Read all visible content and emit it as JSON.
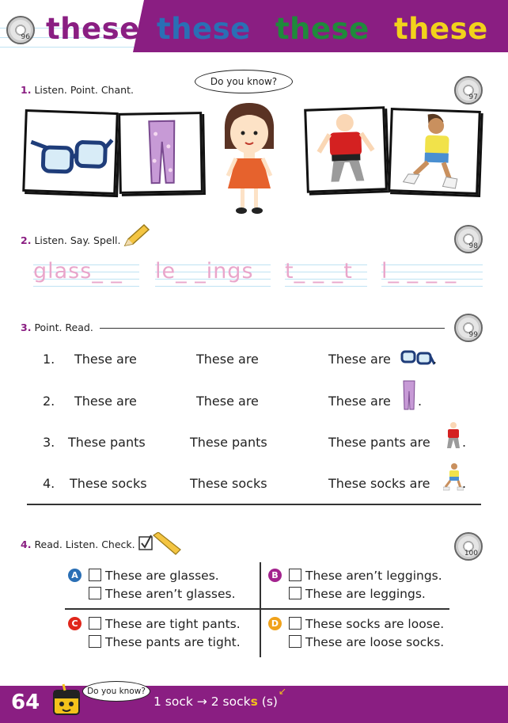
{
  "header": {
    "words": [
      {
        "text": "these",
        "color": "#8a1e82"
      },
      {
        "text": "these",
        "color": "#2a6fb5"
      },
      {
        "text": "these",
        "color": "#1f8a3b"
      },
      {
        "text": "these",
        "color": "#f2d21b"
      }
    ],
    "cd_track": "96"
  },
  "section1": {
    "number": "1.",
    "title": "Listen. Point. Chant.",
    "cd_track": "97",
    "bubble": "Do you know?"
  },
  "section2": {
    "number": "2.",
    "title": "Listen. Say. Spell.",
    "cd_track": "98",
    "words": [
      "glass_ _",
      "le_ _ings",
      "t_ _ _t",
      "l_ _ _ _"
    ]
  },
  "section3": {
    "number": "3.",
    "title": "Point. Read.",
    "cd_track": "99",
    "rows": [
      {
        "num": "1.",
        "c1": "These are",
        "c2": "These are",
        "c3": "These are",
        "icon": "glasses-icon"
      },
      {
        "num": "2.",
        "c1": "These are",
        "c2": "These are",
        "c3": "These are",
        "icon": "leggings-icon"
      },
      {
        "num": "3.",
        "c1": "These pants",
        "c2": "These pants",
        "c3": "These pants are",
        "icon": "boy-red-shirt-icon"
      },
      {
        "num": "4.",
        "c1": "These socks",
        "c2": "These socks",
        "c3": "These socks are",
        "icon": "boy-yellow-shirt-icon"
      }
    ]
  },
  "section4": {
    "number": "4.",
    "title": "Read. Listen. Check.",
    "cd_track": "100",
    "groups": [
      {
        "badge": "A",
        "color": "#2a6fb5",
        "options": [
          "These are glasses.",
          "These aren’t glasses."
        ]
      },
      {
        "badge": "B",
        "color": "#a3238e",
        "options": [
          "These aren’t leggings.",
          "These are leggings."
        ]
      },
      {
        "badge": "C",
        "color": "#e0261b",
        "options": [
          "These are tight pants.",
          "These pants are tight."
        ]
      },
      {
        "badge": "D",
        "color": "#f0a21b",
        "options": [
          "These socks are loose.",
          "These are loose socks."
        ]
      }
    ]
  },
  "footer": {
    "page": "64",
    "bubble": "Do you know?",
    "note_1": "1 sock",
    "arrow": "→",
    "note_2": "2 sock",
    "note_s": "s",
    "note_3": "(s)"
  }
}
